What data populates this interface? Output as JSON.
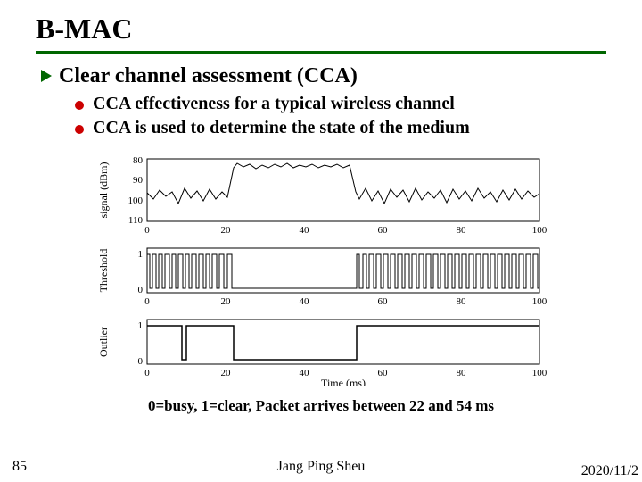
{
  "title": "B-MAC",
  "heading": "Clear channel assessment (CCA)",
  "points": [
    "CCA effectiveness for a typical wireless channel",
    "CCA is used to determine the state of the medium"
  ],
  "caption": "0=busy, 1=clear, Packet arrives between 22 and 54 ms",
  "slide_number": "85",
  "author": "Jang Ping Sheu",
  "date": "2020/11/2",
  "chart_data": [
    {
      "type": "line",
      "title": "",
      "xlabel": "",
      "ylabel": "signal (dBm)",
      "xlim": [
        0,
        100
      ],
      "ylim": [
        -110,
        -80
      ],
      "yticks": [
        -80,
        -90,
        -100,
        -110
      ],
      "xticks": [
        0,
        20,
        40,
        60,
        80,
        100
      ],
      "series": [
        {
          "name": "signal",
          "x": [
            0,
            2,
            4,
            6,
            8,
            10,
            12,
            14,
            16,
            18,
            20,
            22,
            24,
            26,
            28,
            30,
            32,
            34,
            36,
            38,
            40,
            42,
            44,
            46,
            48,
            50,
            52,
            54,
            56,
            58,
            60,
            62,
            64,
            66,
            68,
            70,
            72,
            74,
            76,
            78,
            80,
            82,
            84,
            86,
            88,
            90,
            92,
            94,
            96,
            98,
            100
          ],
          "y": [
            -96,
            -99,
            -94,
            -97,
            -95,
            -100,
            -94,
            -98,
            -95,
            -99,
            -94,
            -85,
            -83,
            -84,
            -83,
            -85,
            -84,
            -83,
            -85,
            -84,
            -83,
            -85,
            -84,
            -83,
            -85,
            -84,
            -83,
            -95,
            -98,
            -94,
            -99,
            -95,
            -100,
            -94,
            -97,
            -95,
            -99,
            -94,
            -98,
            -95,
            -100,
            -94,
            -97,
            -95,
            -99,
            -94,
            -98,
            -95,
            -99,
            -94,
            -97
          ]
        }
      ]
    },
    {
      "type": "line",
      "title": "",
      "xlabel": "",
      "ylabel": "Threshold",
      "xlim": [
        0,
        100
      ],
      "ylim": [
        0,
        1
      ],
      "yticks": [
        0,
        1
      ],
      "xticks": [
        0,
        20,
        40,
        60,
        80,
        100
      ],
      "series": [
        {
          "name": "threshold",
          "x": [
            0,
            1,
            2,
            3,
            4,
            5,
            6,
            7,
            8,
            9,
            10,
            11,
            12,
            13,
            14,
            15,
            16,
            17,
            18,
            19,
            20,
            21,
            22,
            54,
            55,
            56,
            57,
            58,
            59,
            60,
            61,
            62,
            63,
            64,
            65,
            66,
            67,
            68,
            69,
            70,
            71,
            72,
            73,
            74,
            75,
            76,
            77,
            78,
            79,
            80,
            81,
            82,
            83,
            84,
            85,
            86,
            87,
            88,
            89,
            90,
            91,
            92,
            93,
            94,
            95,
            96,
            97,
            98,
            99,
            100
          ],
          "y": [
            1,
            0,
            1,
            0,
            1,
            1,
            0,
            1,
            0,
            1,
            0,
            1,
            1,
            0,
            1,
            0,
            1,
            0,
            1,
            1,
            0,
            1,
            0,
            0,
            1,
            0,
            1,
            0,
            1,
            1,
            0,
            1,
            0,
            1,
            0,
            1,
            1,
            0,
            1,
            0,
            1,
            0,
            1,
            1,
            0,
            1,
            0,
            1,
            0,
            1,
            0,
            1,
            1,
            0,
            1,
            0,
            1,
            0,
            1,
            1,
            0,
            1,
            0,
            1,
            0,
            1,
            1,
            0,
            1,
            0
          ]
        }
      ]
    },
    {
      "type": "line",
      "title": "",
      "xlabel": "Time (ms)",
      "ylabel": "Outlier",
      "xlim": [
        0,
        100
      ],
      "ylim": [
        0,
        1
      ],
      "yticks": [
        0,
        1
      ],
      "xticks": [
        0,
        20,
        40,
        60,
        80,
        100
      ],
      "series": [
        {
          "name": "outlier",
          "x": [
            0,
            9,
            9,
            10,
            10,
            22,
            22,
            54,
            54,
            100
          ],
          "y": [
            1,
            1,
            0,
            0,
            1,
            1,
            0,
            0,
            1,
            1
          ]
        }
      ]
    }
  ]
}
